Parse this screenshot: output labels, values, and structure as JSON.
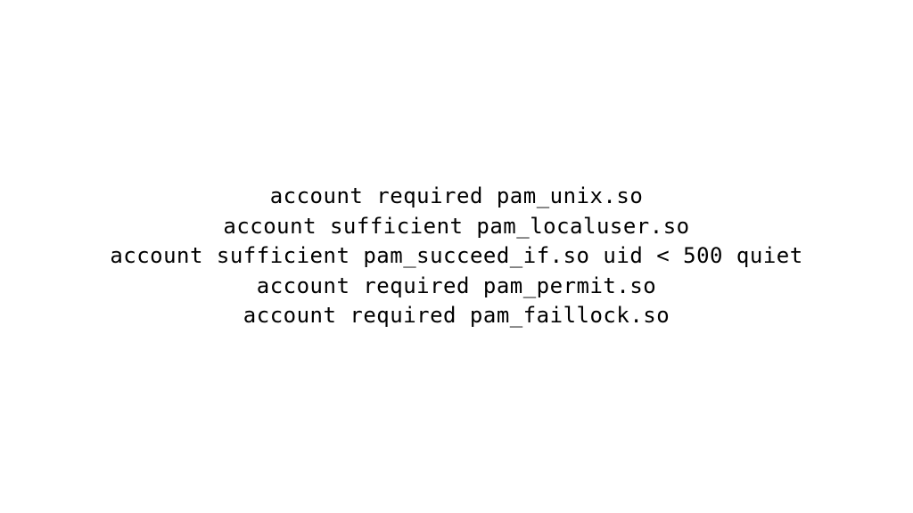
{
  "config": {
    "lines": [
      "account required pam_unix.so",
      "account sufficient pam_localuser.so",
      "account sufficient pam_succeed_if.so uid < 500 quiet",
      "account required pam_permit.so",
      "account required pam_faillock.so"
    ]
  }
}
